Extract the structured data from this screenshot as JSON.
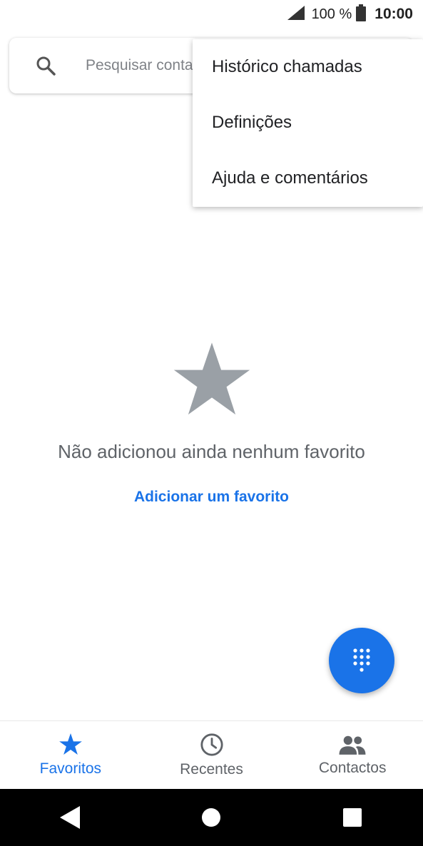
{
  "status_bar": {
    "battery_percent": "100 %",
    "time": "10:00"
  },
  "search": {
    "placeholder": "Pesquisar contactos"
  },
  "menu": {
    "items": [
      {
        "label": "Histórico chamadas"
      },
      {
        "label": "Definições"
      },
      {
        "label": "Ajuda e comentários"
      }
    ]
  },
  "empty_state": {
    "message": "Não adicionou ainda nenhum favorito",
    "action": "Adicionar um favorito"
  },
  "bottom_nav": {
    "items": [
      {
        "label": "Favoritos",
        "active": true
      },
      {
        "label": "Recentes",
        "active": false
      },
      {
        "label": "Contactos",
        "active": false
      }
    ]
  },
  "colors": {
    "accent": "#1a73e8",
    "icon_gray": "#9aa0a6",
    "text_gray": "#5f6368"
  }
}
